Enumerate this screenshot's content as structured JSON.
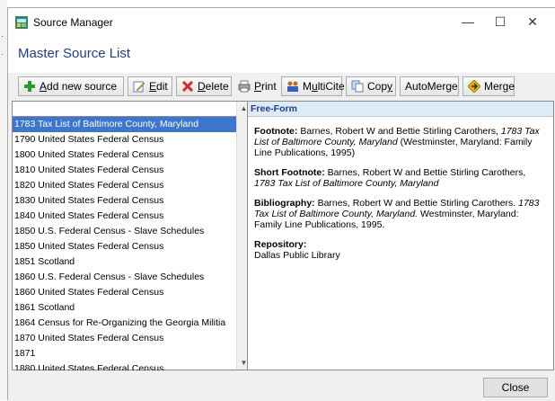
{
  "window": {
    "title": "Source Manager",
    "heading": "Master Source List",
    "minimize": "—",
    "maximize": "☐",
    "close": "✕"
  },
  "toolbar": {
    "add_prefix": "",
    "add_u": "A",
    "add_rest": "dd new source",
    "edit_u": "E",
    "edit_rest": "dit",
    "delete_u": "D",
    "delete_rest": "elete",
    "print_u": "P",
    "print_rest": "rint",
    "multicite_pre": "M",
    "multicite_u": "u",
    "multicite_rest": "ltiCite",
    "copy_pre": "Cop",
    "copy_u": "y",
    "automerge_pre": "AutoMer",
    "automerge_u": "g",
    "automerge_rest": "e",
    "merge_label": "Merge"
  },
  "sources": [
    "1783 Tax List of Baltimore County, Maryland",
    "1790 United States Federal Census",
    "1800 United States Federal Census",
    "1810 United States Federal Census",
    "1820 United States Federal Census",
    "1830 United States Federal Census",
    "1840 United States Federal Census",
    "1850 U.S. Federal Census - Slave Schedules",
    "1850 United States Federal Census",
    "1851 Scotland",
    "1860 U.S. Federal Census - Slave Schedules",
    "1860 United States Federal Census",
    "1861 Scotland",
    "1864 Census for Re-Organizing the Georgia Militia",
    "1870 United States Federal Census",
    "1871",
    "1880 United States Federal Census"
  ],
  "selected_index": 0,
  "detail": {
    "header": "Free-Form",
    "footnote_label": "Footnote:",
    "footnote_authors": "Barnes, Robert W and Bettie Stirling Carothers,",
    "footnote_title": "1783 Tax List of Baltimore County, Maryland",
    "footnote_pub": "(Westminster, Maryland: Family Line Publications, 1995)",
    "short_label": "Short Footnote:",
    "short_authors": "Barnes, Robert W and Bettie Stirling Carothers,",
    "short_title": "1783 Tax List of Baltimore County, Maryland",
    "bib_label": "Bibliography:",
    "bib_authors": "Barnes, Robert W and Bettie Stirling Carothers.",
    "bib_title": "1783 Tax List of Baltimore County, Maryland.",
    "bib_pub": "Westminster, Maryland: Family Line Publications, 1995.",
    "repo_label": "Repository:",
    "repo_value": "Dallas Public Library"
  },
  "footer": {
    "close_label": "Close"
  }
}
